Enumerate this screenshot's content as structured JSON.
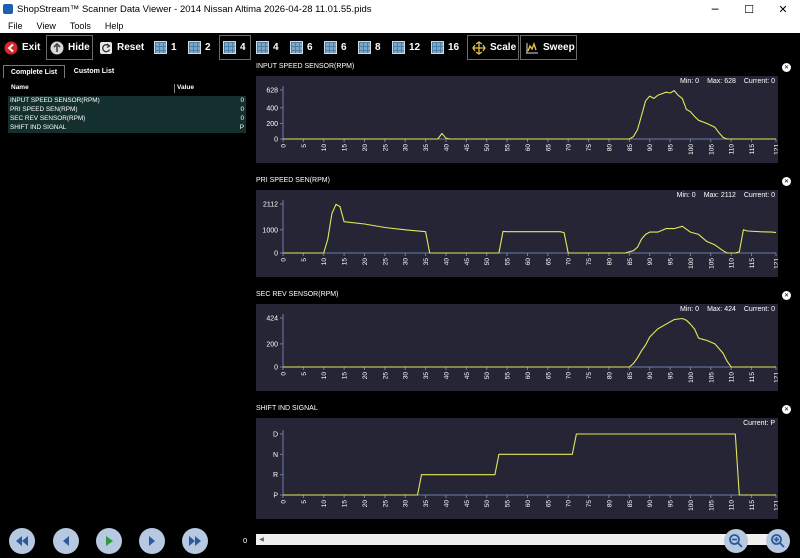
{
  "window": {
    "title": "ShopStream™ Scanner Data Viewer - 2014 Nissan Altima 2026-04-28 11.01.55.pids",
    "minimize": "─",
    "maximize": "☐",
    "close": "✕"
  },
  "menu": [
    "File",
    "View",
    "Tools",
    "Help"
  ],
  "toolbar": {
    "exit_label": "Exit",
    "hide_label": "Hide",
    "reset_label": "Reset",
    "layouts": [
      "1",
      "2",
      "4",
      "4",
      "6",
      "6",
      "8",
      "12",
      "16"
    ],
    "scale_label": "Scale",
    "sweep_label": "Sweep"
  },
  "left_panel": {
    "tabs": [
      "Complete List",
      "Custom List"
    ],
    "header": {
      "name": "Name",
      "value": "Value"
    },
    "rows": [
      {
        "name": "INPUT SPEED SENSOR(RPM)",
        "value": "0"
      },
      {
        "name": "PRI SPEED SEN(RPM)",
        "value": "0"
      },
      {
        "name": "SEC REV SENSOR(RPM)",
        "value": "0"
      },
      {
        "name": "SHIFT IND SIGNAL",
        "value": "P"
      }
    ]
  },
  "colors": {
    "trace": "#e4e85a",
    "plot_bg": "#252535",
    "axis": "#6b7fa8"
  },
  "graphs": [
    {
      "title": "INPUT SPEED SENSOR(RPM)",
      "stats": {
        "min": "Min: 0",
        "max": "Max: 628",
        "current": "Current: 0"
      }
    },
    {
      "title": "PRI SPEED SEN(RPM)",
      "stats": {
        "min": "Min: 0",
        "max": "Max: 2112",
        "current": "Current: 0"
      }
    },
    {
      "title": "SEC REV SENSOR(RPM)",
      "stats": {
        "min": "Min: 0",
        "max": "Max: 424",
        "current": "Current: 0"
      }
    },
    {
      "title": "SHIFT IND SIGNAL",
      "stats": {
        "min": "",
        "max": "",
        "current": "Current: P"
      }
    }
  ],
  "x_ticks": [
    "0",
    "5",
    "10",
    "15",
    "20",
    "25",
    "30",
    "35",
    "40",
    "45",
    "50",
    "55",
    "60",
    "65",
    "70",
    "75",
    "80",
    "85",
    "90",
    "95",
    "100",
    "105",
    "110",
    "115",
    "121"
  ],
  "chart_data": [
    {
      "type": "line",
      "title": "INPUT SPEED SENSOR(RPM)",
      "ylim": [
        0,
        628
      ],
      "ticks": [
        "0",
        "200",
        "400",
        "628"
      ],
      "xlim": [
        0,
        121
      ],
      "x": [
        0,
        38,
        39,
        40,
        41,
        85,
        86,
        87,
        88,
        89,
        90,
        91,
        92,
        93,
        94,
        95,
        96,
        97,
        98,
        99,
        100,
        101,
        102,
        104,
        106,
        107,
        108,
        109,
        110,
        121
      ],
      "y": [
        0,
        0,
        70,
        10,
        0,
        0,
        30,
        120,
        300,
        490,
        550,
        520,
        560,
        580,
        600,
        590,
        620,
        560,
        520,
        380,
        350,
        290,
        240,
        200,
        150,
        80,
        20,
        0,
        0,
        0
      ]
    },
    {
      "type": "line",
      "title": "PRI SPEED SEN(RPM)",
      "ylim": [
        0,
        2112
      ],
      "ticks": [
        "0",
        "1000",
        "2112"
      ],
      "xlim": [
        0,
        121
      ],
      "x": [
        0,
        10,
        11,
        12,
        13,
        14,
        15,
        20,
        25,
        30,
        35,
        36,
        37,
        53,
        54,
        55,
        68,
        69,
        70,
        84,
        85,
        86,
        87,
        88,
        89,
        90,
        92,
        94,
        96,
        98,
        100,
        102,
        104,
        106,
        108,
        109,
        110,
        111,
        112,
        113,
        114,
        117,
        120,
        121
      ],
      "y": [
        0,
        0,
        600,
        1700,
        2100,
        2000,
        1350,
        1250,
        1100,
        1000,
        920,
        0,
        0,
        0,
        930,
        920,
        920,
        880,
        0,
        0,
        50,
        100,
        250,
        600,
        800,
        900,
        900,
        1050,
        1050,
        1150,
        900,
        800,
        500,
        350,
        100,
        0,
        0,
        0,
        50,
        1000,
        950,
        920,
        900,
        880
      ]
    },
    {
      "type": "line",
      "title": "SEC REV SENSOR(RPM)",
      "ylim": [
        0,
        424
      ],
      "ticks": [
        "0",
        "200",
        "424"
      ],
      "xlim": [
        0,
        121
      ],
      "x": [
        0,
        85,
        86,
        87,
        88,
        89,
        90,
        92,
        94,
        96,
        98,
        99,
        100,
        101,
        102,
        103,
        104,
        106,
        108,
        109,
        110,
        121
      ],
      "y": [
        0,
        0,
        30,
        80,
        140,
        190,
        260,
        330,
        370,
        410,
        420,
        405,
        370,
        330,
        250,
        240,
        230,
        200,
        120,
        50,
        0,
        0
      ]
    },
    {
      "type": "line",
      "title": "SHIFT IND SIGNAL",
      "ylim": [
        0,
        3
      ],
      "ticks": [
        "P",
        "R",
        "N",
        "D"
      ],
      "xlim": [
        0,
        121
      ],
      "x": [
        0,
        33,
        34,
        52,
        53,
        71,
        72,
        111,
        112,
        121
      ],
      "y": [
        0,
        0,
        1,
        1,
        2,
        2,
        3,
        3,
        0,
        0
      ]
    }
  ],
  "bottom": {
    "position": "0",
    "scroll_left": "◀",
    "scroll_right": "▶"
  }
}
